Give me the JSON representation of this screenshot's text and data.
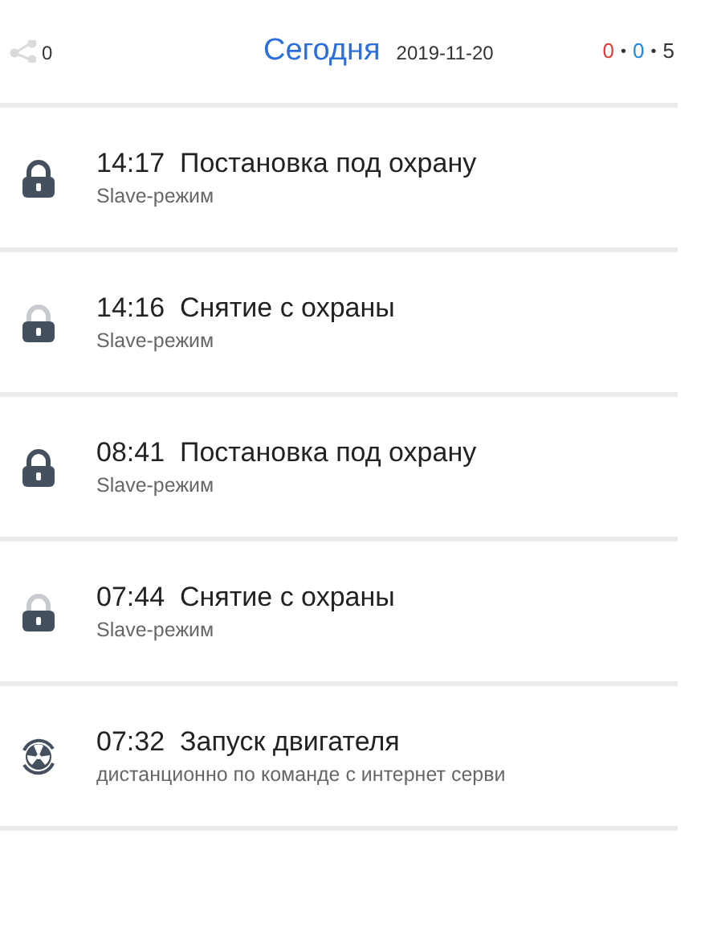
{
  "header": {
    "share_count": "0",
    "title": "Сегодня",
    "date": "2019-11-20",
    "counters": [
      {
        "value": "0",
        "color": "#e53935"
      },
      {
        "value": "0",
        "color": "#1e88e5"
      },
      {
        "value": "5",
        "color": "#333333"
      }
    ],
    "separator": "•"
  },
  "events": [
    {
      "kind": "arm",
      "time": "14:17",
      "title": "Постановка под охрану",
      "subtitle": "Slave-режим"
    },
    {
      "kind": "disarm",
      "time": "14:16",
      "title": "Снятие с охраны",
      "subtitle": "Slave-режим"
    },
    {
      "kind": "arm",
      "time": "08:41",
      "title": "Постановка под охрану",
      "subtitle": "Slave-режим"
    },
    {
      "kind": "disarm",
      "time": "07:44",
      "title": "Снятие с охраны",
      "subtitle": "Slave-режим"
    },
    {
      "kind": "engine",
      "time": "07:32",
      "title": "Запуск двигателя",
      "subtitle": "дистанционно по команде с интернет серви"
    }
  ]
}
